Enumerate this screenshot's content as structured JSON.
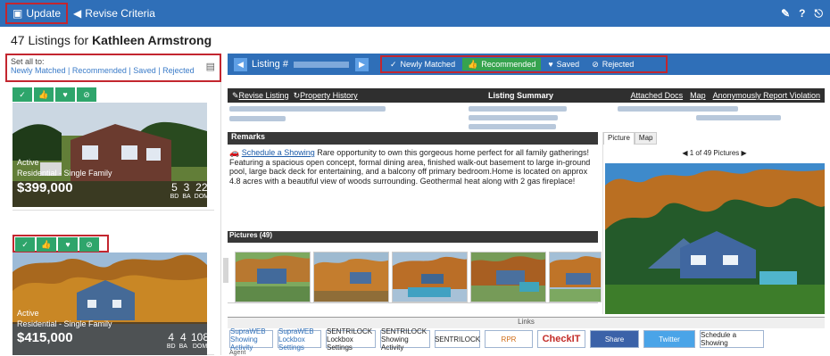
{
  "toolbar": {
    "update_label": "Update",
    "revise_label": "Revise Criteria"
  },
  "page": {
    "title_prefix": "47 Listings for ",
    "client_name": "Kathleen Armstrong"
  },
  "left_panel": {
    "set_all_label": "Set all to:",
    "set_links": [
      "Newly Matched",
      "Recommended",
      "Saved",
      "Rejected"
    ],
    "cards": [
      {
        "status": "Active",
        "type": "Residential - Single Family",
        "price": "$399,000",
        "bd": "5",
        "ba": "3",
        "dom": "22",
        "bd_label": "BD",
        "ba_label": "BA",
        "dom_label": "DOM"
      },
      {
        "status": "Active",
        "type": "Residential - Single Family",
        "price": "$415,000",
        "bd": "4",
        "ba": "4",
        "dom": "108",
        "bd_label": "BD",
        "ba_label": "BA",
        "dom_label": "DOM"
      }
    ]
  },
  "listing_bar": {
    "label": "Listing #",
    "filters": [
      "Newly Matched",
      "Recommended",
      "Saved",
      "Rejected"
    ]
  },
  "summary": {
    "revise_label": "Revise Listing",
    "history_label": "Property History",
    "title": "Listing Summary",
    "attached_docs": "Attached Docs",
    "map": "Map",
    "report": "Anonymously Report Violation"
  },
  "remarks": {
    "heading": "Remarks",
    "schedule_link": "Schedule a Showing",
    "text": " Rare opportunity to own this gorgeous home perfect for all family gatherings! Featuring a spacious open concept, formal dining area, finished walk-out basement to large in-ground pool, large back deck for entertaining, and a balcony off primary bedroom.Home is located on approx 4.8 acres with a beautiful view of woods surrounding. Geothermal heat along with 2 gas fireplace!"
  },
  "pictures": {
    "heading": "Pictures (49)"
  },
  "photo_panel": {
    "tab_picture": "Picture",
    "tab_map": "Map",
    "pagination": "1 of 49 Pictures"
  },
  "links": {
    "heading": "Links",
    "logos": [
      "SupraWEB Showing Activity",
      "SupraWEB Lockbox Settings",
      "SENTRILOCK Lockbox Settings",
      "SENTRILOCK Showing Activity",
      "SENTRILOCK",
      "RPR",
      "CheckIT",
      "Share",
      "Twitter",
      "Schedule a Showing"
    ]
  },
  "agent_label": "Agent"
}
